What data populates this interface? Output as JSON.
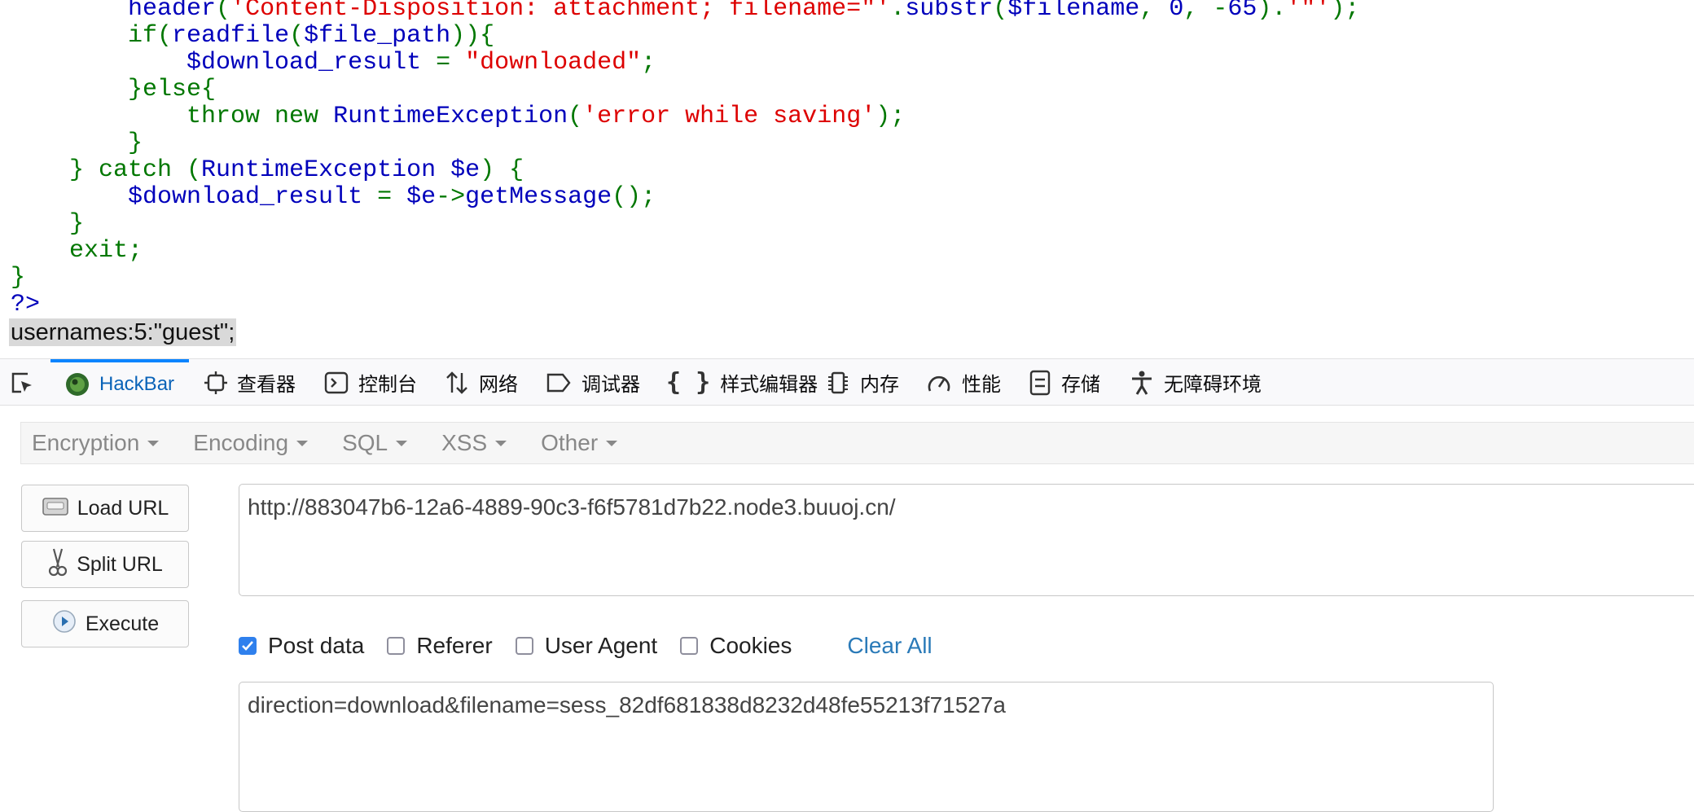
{
  "code": {
    "lines": [
      [
        [
          "b",
          "        header"
        ],
        [
          "g",
          "("
        ],
        [
          "r",
          "'Content-Disposition: attachment; filename=\"'"
        ],
        [
          "g",
          "."
        ],
        [
          "b",
          "substr"
        ],
        [
          "g",
          "("
        ],
        [
          "b",
          "$filename"
        ],
        [
          "g",
          ", "
        ],
        [
          "b",
          "0"
        ],
        [
          "g",
          ", -"
        ],
        [
          "b",
          "65"
        ],
        [
          "g",
          ")."
        ],
        [
          "r",
          "'\"'"
        ],
        [
          "g",
          ");"
        ]
      ],
      [
        [
          "g",
          "        if("
        ],
        [
          "b",
          "readfile"
        ],
        [
          "g",
          "("
        ],
        [
          "b",
          "$file_path"
        ],
        [
          "g",
          "))"
        ],
        [
          "g",
          "{"
        ]
      ],
      [
        [
          "b",
          "            $download_result "
        ],
        [
          "g",
          "= "
        ],
        [
          "r",
          "\"downloaded\""
        ],
        [
          "g",
          ";"
        ]
      ],
      [
        [
          "g",
          "        }else{"
        ]
      ],
      [
        [
          "g",
          "            throw new "
        ],
        [
          "b",
          "RuntimeException"
        ],
        [
          "g",
          "("
        ],
        [
          "r",
          "'error while saving'"
        ],
        [
          "g",
          ");"
        ]
      ],
      [
        [
          "g",
          "        }"
        ]
      ],
      [
        [
          "g",
          "    } catch ("
        ],
        [
          "b",
          "RuntimeException $e"
        ],
        [
          "g",
          ") {"
        ]
      ],
      [
        [
          "b",
          "        $download_result "
        ],
        [
          "g",
          "= "
        ],
        [
          "b",
          "$e"
        ],
        [
          "g",
          "->"
        ],
        [
          "b",
          "getMessage"
        ],
        [
          "g",
          "();"
        ]
      ],
      [
        [
          "g",
          "    }"
        ]
      ],
      [
        [
          "g",
          "    exit;"
        ]
      ],
      [
        [
          "g",
          "}"
        ]
      ],
      [
        [
          "b",
          "?>"
        ]
      ]
    ],
    "output_line": "usernames:5:\"guest\";"
  },
  "devtools": {
    "tabs": [
      {
        "name": "hackbar",
        "label": "HackBar",
        "icon": "hackbar-logo-icon",
        "active": true
      },
      {
        "name": "inspector",
        "label": "查看器",
        "icon": "inspector-icon"
      },
      {
        "name": "console",
        "label": "控制台",
        "icon": "console-icon"
      },
      {
        "name": "network",
        "label": "网络",
        "icon": "network-icon"
      },
      {
        "name": "debugger",
        "label": "调试器",
        "icon": "debugger-icon"
      },
      {
        "name": "style-editor",
        "label": "样式编辑器",
        "icon": "style-editor-icon"
      },
      {
        "name": "memory",
        "label": "内存",
        "icon": "memory-icon"
      },
      {
        "name": "performance",
        "label": "性能",
        "icon": "performance-icon"
      },
      {
        "name": "storage",
        "label": "存储",
        "icon": "storage-icon"
      },
      {
        "name": "accessibility",
        "label": "无障碍环境",
        "icon": "accessibility-icon"
      }
    ]
  },
  "hackbar": {
    "menus": [
      "Encryption",
      "Encoding",
      "SQL",
      "XSS",
      "Other"
    ],
    "buttons": {
      "load_url": "Load URL",
      "split_url": "Split URL",
      "execute": "Execute"
    },
    "url_value": "http://883047b6-12a6-4889-90c3-f6f5781d7b22.node3.buuoj.cn/",
    "options": [
      {
        "label": "Post data",
        "checked": true
      },
      {
        "label": "Referer",
        "checked": false
      },
      {
        "label": "User Agent",
        "checked": false
      },
      {
        "label": "Cookies",
        "checked": false
      }
    ],
    "clear_all": "Clear All",
    "post_value": "direction=download&filename=sess_82df681838d8232d48fe55213f71527a"
  },
  "colors": {
    "php_keyword": "#007700",
    "php_default": "#0000bb",
    "php_string": "#dd0000",
    "tab_active": "#0a84ff",
    "link": "#2a7ab8"
  }
}
